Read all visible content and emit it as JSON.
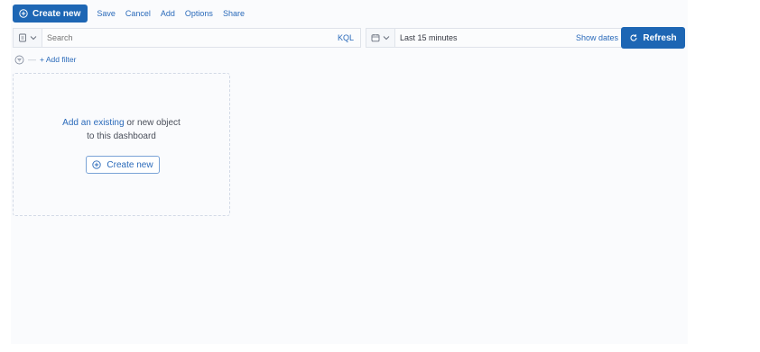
{
  "topnav": {
    "create_new": "Create new",
    "save": "Save",
    "cancel": "Cancel",
    "add": "Add",
    "options": "Options",
    "share": "Share"
  },
  "query": {
    "placeholder": "Search",
    "language": "KQL"
  },
  "date": {
    "range": "Last 15 minutes",
    "show_dates": "Show dates"
  },
  "refresh_label": "Refresh",
  "filter": {
    "add_filter": "+ Add filter"
  },
  "empty_panel": {
    "link_text": "Add an existing",
    "line1_rest": " or new object",
    "line2": "to this dashboard",
    "create_new": "Create new"
  },
  "colors": {
    "primary": "#1d66b4",
    "link": "#2a6aba",
    "background": "#fafbfd"
  }
}
